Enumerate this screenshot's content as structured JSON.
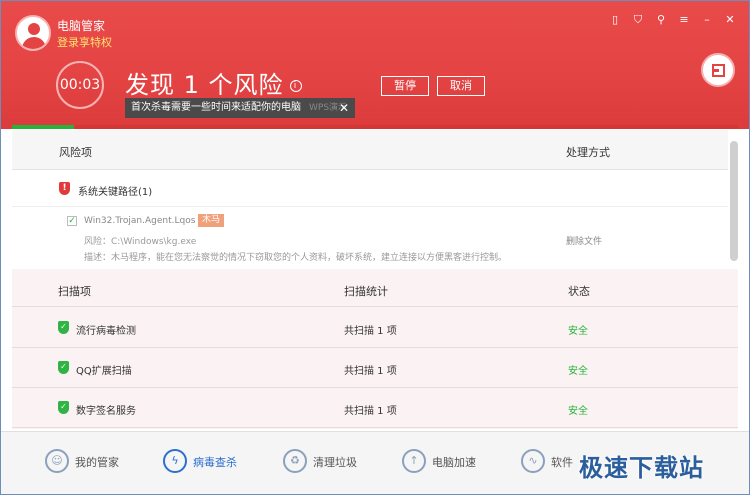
{
  "header": {
    "app_name": "电脑管家",
    "login_link": "登录享特权",
    "timer": "00:03",
    "headline": "发现 1 个风险",
    "info_glyph": "i",
    "pause_label": "暂停",
    "cancel_label": "取消",
    "tooltip_text": "首次杀毒需要一些时间来适配你的电脑",
    "tooltip_ghost": "WPS演示",
    "tooltip_close": "✕",
    "progress": 0.085,
    "top_icons": [
      "phone-icon",
      "shield-icon",
      "shirt-icon",
      "menu-icon",
      "minimize-icon",
      "close-icon"
    ],
    "colors": {
      "header_red": "#e44343",
      "safe_green": "#27b33a",
      "accent_blue": "#2d6ed1"
    }
  },
  "risk": {
    "col_item": "风险项",
    "col_action": "处理方式",
    "group_label": "系统关键路径(1)",
    "group_glyph": "!",
    "item": {
      "check_glyph": "✓",
      "name": "Win32.Trojan.Agent.Lqos",
      "tag": "木马",
      "path": "风险：C:\\Windows\\kg.exe",
      "desc": "描述：木马程序，能在您无法察觉的情况下窃取您的个人资料，破坏系统，建立连接以方便黑客进行控制。",
      "action": "删除文件"
    }
  },
  "scan": {
    "col_item": "扫描项",
    "col_stat": "扫描统计",
    "col_state": "状态",
    "ok_glyph": "✓",
    "rows": [
      {
        "name": "流行病毒检测",
        "stat": "共扫描 1 项",
        "state": "安全"
      },
      {
        "name": "QQ扩展扫描",
        "stat": "共扫描 1 项",
        "state": "安全"
      },
      {
        "name": "数字签名服务",
        "stat": "共扫描 1 项",
        "state": "安全"
      }
    ]
  },
  "nav": {
    "items": [
      {
        "label": "我的管家",
        "icon": "person-icon",
        "glyph": "☺"
      },
      {
        "label": "病毒查杀",
        "icon": "lightning-shield-icon",
        "glyph": "ϟ"
      },
      {
        "label": "清理垃圾",
        "icon": "broom-icon",
        "glyph": "♻"
      },
      {
        "label": "电脑加速",
        "icon": "rocket-icon",
        "glyph": "↑"
      },
      {
        "label": "软件",
        "icon": "pulse-icon",
        "glyph": "∿"
      }
    ]
  },
  "watermark": "极速下载站"
}
